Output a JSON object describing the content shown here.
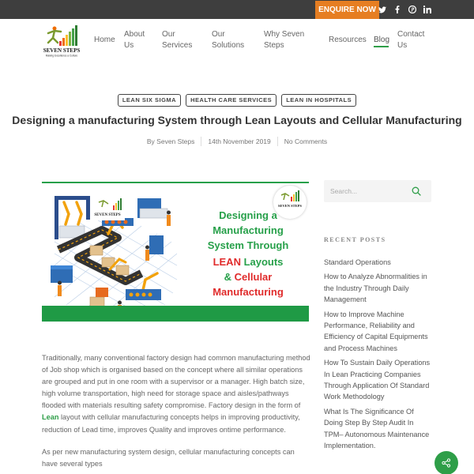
{
  "topbar": {
    "enquire_label": "ENQUIRE NOW",
    "social": [
      {
        "icon": "twitter-icon",
        "glyph": "🐦"
      },
      {
        "icon": "facebook-icon",
        "glyph": "f"
      },
      {
        "icon": "pinterest-icon",
        "glyph": "℗"
      },
      {
        "icon": "linkedin-icon",
        "glyph": "in"
      }
    ],
    "colors": {
      "bar": "#3e3e3e",
      "enquire": "#e67e22"
    }
  },
  "logo": {
    "name": "SEVEN STEPS",
    "tagline": "Making Excellence a Culture"
  },
  "nav": {
    "items": [
      {
        "label_line1": "Home",
        "label_line2": ""
      },
      {
        "label_line1": "About",
        "label_line2": "Us"
      },
      {
        "label_line1": "Our",
        "label_line2": "Services"
      },
      {
        "label_line1": "Our",
        "label_line2": "Solutions"
      },
      {
        "label_line1": "Why Seven",
        "label_line2": "Steps"
      },
      {
        "label_line1": "Resources",
        "label_line2": ""
      },
      {
        "label_line1": "Blog",
        "label_line2": ""
      },
      {
        "label_line1": "Contact",
        "label_line2": "Us"
      }
    ],
    "active": "Blog",
    "accent": "#2e9e48"
  },
  "post": {
    "tags": [
      "LEAN SIX SIGMA",
      "HEALTH CARE SERVICES",
      "LEAN IN HOSPITALS"
    ],
    "title": "Designing a manufacturing System through Lean Layouts and Cellular Manufacturing",
    "author": "By Seven Steps",
    "date": "14th November 2019",
    "comments": "No Comments",
    "banner": {
      "line1": "Designing a",
      "line2": "Manufacturing",
      "line3": "System Through",
      "line4_red": "LEAN",
      "line4_green": " Layouts",
      "line5_green": "& ",
      "line5_red": "Cellular",
      "line6_red": "Manufacturing"
    },
    "paragraph1_before": "Traditionally, many conventional factory design had common manufacturing method of Job shop which is organised based on the concept where all similar operations are grouped and put in one room with a supervisor or a manager. High batch size, high volume transportation, high need for storage space and aisles/pathways flooded with materials resulting safety compromise. Factory design in the form of ",
    "paragraph1_highlight": "Lean",
    "paragraph1_after": " layout with cellular manufacturing concepts helps in improving productivity, reduction of Lead time, improves Quality and improves ontime performance.",
    "paragraph2": "As per new manufacturing  system design, cellular manufacturing concepts can have several types"
  },
  "sidebar": {
    "search_placeholder": "Search...",
    "recent_posts_title": "RECENT POSTS",
    "recent_posts": [
      "Standard Operations",
      "How to Analyze Abnormalities in the Industry Through Daily Management",
      "How to Improve Machine Performance, Reliability and Efficiency of Capital Equipments and Process Machines",
      "How To Sustain Daily Operations In Lean Practicing Companies Through Application Of Standard Work Methodology",
      "What Is The Significance Of Doing Step By Step Audit In TPM– Autonomous Maintenance Implementation."
    ]
  },
  "share": {
    "icon": "share-icon",
    "color": "#2e9e48"
  }
}
